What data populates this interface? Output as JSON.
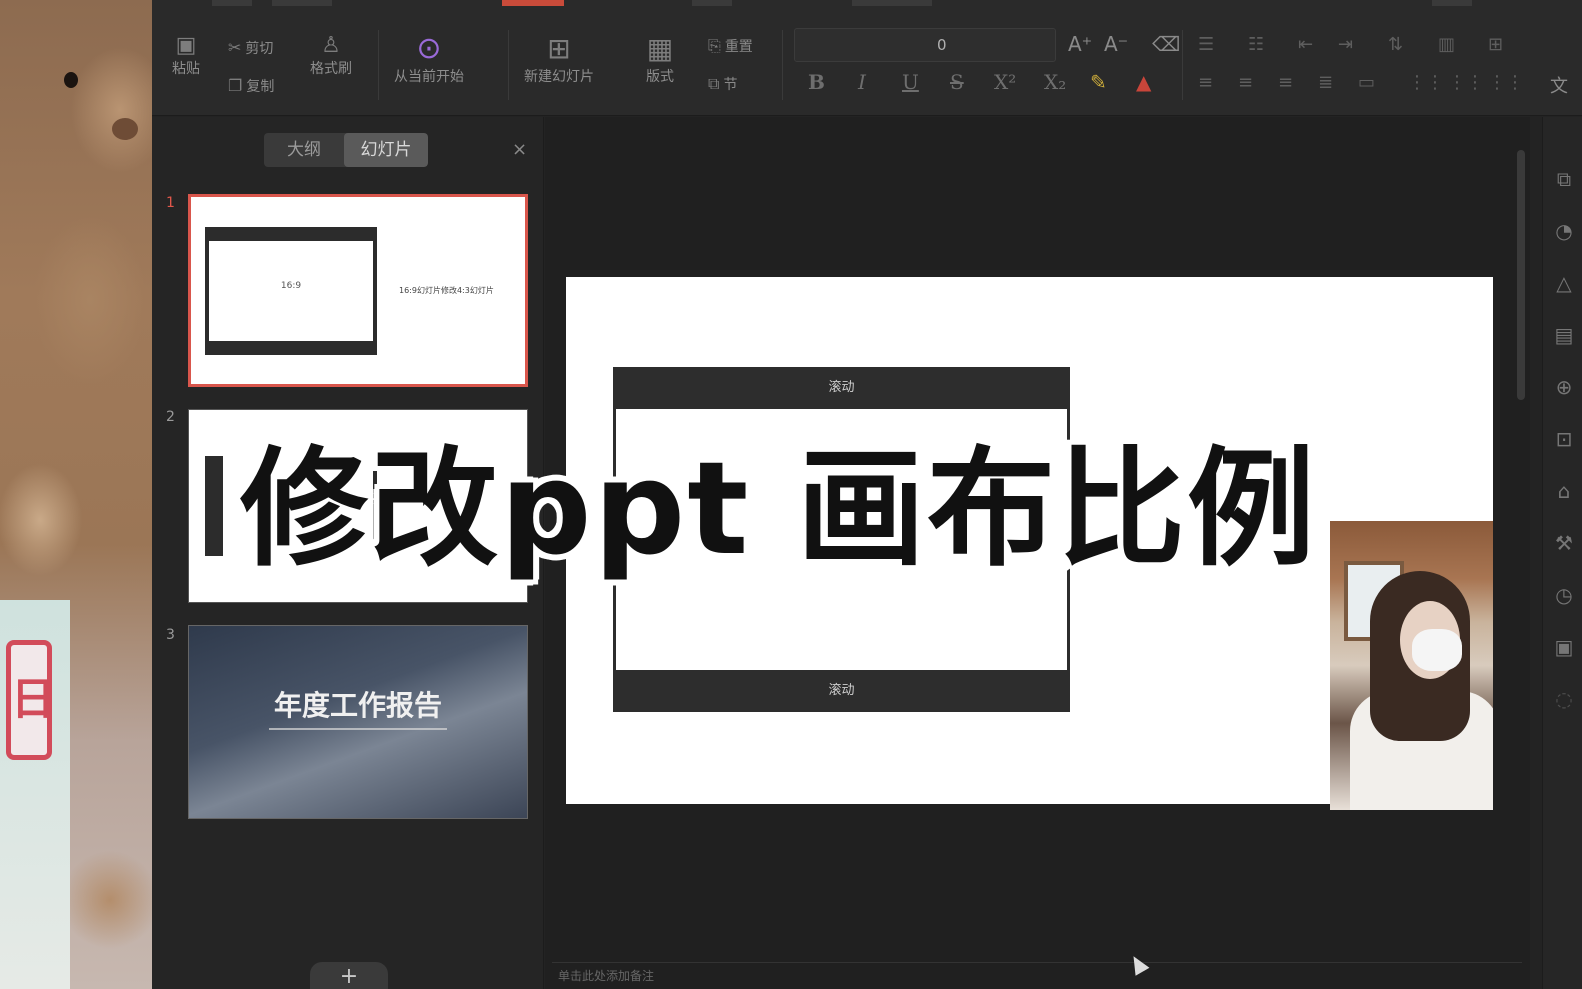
{
  "ribbon": {
    "paste": "粘贴",
    "cut": "剪切",
    "copy": "复制",
    "format_painter": "格式刷",
    "play_from_current": "从当前开始",
    "new_slide": "新建幻灯片",
    "layout": "版式",
    "reset": "重置",
    "section": "节",
    "font_size": "0",
    "bold": "B",
    "italic": "I",
    "underline": "U",
    "strike": "S",
    "superscript": "X²",
    "subscript": "X₂"
  },
  "pane": {
    "tab_outline": "大纲",
    "tab_slides": "幻灯片",
    "close": "×",
    "add": "+",
    "slides": [
      {
        "number": "1",
        "frame_label": "16:9",
        "caption": "16:9幻灯片修改4:3幻灯片"
      },
      {
        "number": "2"
      },
      {
        "number": "3",
        "title": "年度工作报告"
      }
    ]
  },
  "slide": {
    "bar_top": "滚动",
    "bar_bottom": "滚动"
  },
  "status": {
    "notes_placeholder": "单击此处添加备注"
  },
  "overlay": {
    "title": "修改ppt 画布比例"
  },
  "colors": {
    "accent_red": "#d9564c",
    "ribbon_bg": "#2a2a2a",
    "canvas_bg": "#202020"
  }
}
